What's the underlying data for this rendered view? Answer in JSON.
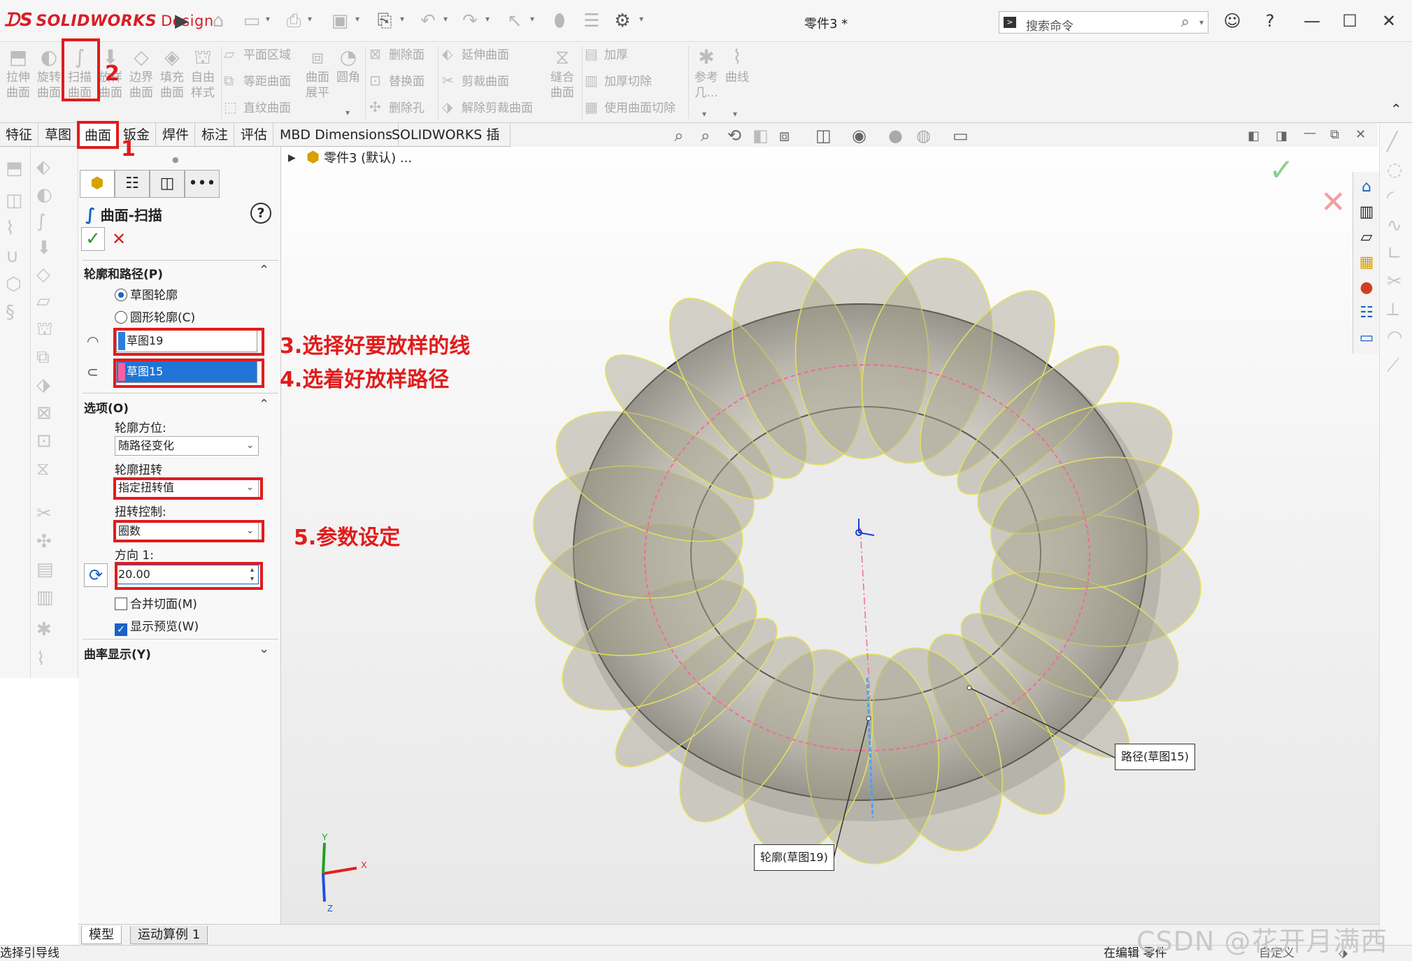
{
  "titlebar": {
    "brand": "SOLIDWORKS",
    "brand_suffix": "Design",
    "doc_title": "零件3 *",
    "search_placeholder": "搜索命令"
  },
  "ribbon": {
    "big_buttons": [
      {
        "line1": "拉伸",
        "line2": "曲面"
      },
      {
        "line1": "旋转",
        "line2": "曲面"
      },
      {
        "line1": "扫描",
        "line2": "曲面"
      },
      {
        "line1": "放样",
        "line2": "曲面"
      },
      {
        "line1": "边界",
        "line2": "曲面"
      },
      {
        "line1": "填充",
        "line2": "曲面"
      },
      {
        "line1": "自由",
        "line2": "样式"
      }
    ],
    "group1": [
      "平面区域",
      "等距曲面",
      "直纹曲面"
    ],
    "surf_flatten": {
      "line1": "曲面",
      "line2": "展平"
    },
    "fillet": "圆角",
    "group2": [
      "删除面",
      "替换面",
      "删除孔"
    ],
    "group3": [
      "延伸曲面",
      "剪裁曲面",
      "解除剪裁曲面"
    ],
    "knit": {
      "line1": "缝合",
      "line2": "曲面"
    },
    "group4": [
      "加厚",
      "加厚切除",
      "使用曲面切除"
    ],
    "ref": {
      "line1": "参考",
      "line2": "几..."
    },
    "curves": "曲线"
  },
  "tabs": [
    "特征",
    "草图",
    "曲面",
    "钣金",
    "焊件",
    "标注",
    "评估",
    "MBD Dimensions",
    "SOLIDWORKS 插件"
  ],
  "tree": {
    "root": "零件3 (默认) ..."
  },
  "pm": {
    "title": "曲面-扫描",
    "help": "?",
    "sec_profile": "轮廓和路径(P)",
    "radio_sketch": "草图轮廓",
    "radio_circle": "圆形轮廓(C)",
    "profile_sel": "草图19",
    "path_sel": "草图15",
    "sec_options": "选项(O)",
    "orient_label": "轮廓方位:",
    "orient_value": "随路径变化",
    "twist_label": "轮廓扭转",
    "twist_value": "指定扭转值",
    "twist_ctrl_label": "扭转控制:",
    "twist_ctrl_value": "圈数",
    "dir_label": "方向 1:",
    "dir_value": "20.00",
    "merge": "合并切面(M)",
    "preview": "显示预览(W)",
    "sec_curv": "曲率显示(Y)"
  },
  "annotations": {
    "n1": "1",
    "n2": "2",
    "n3": "3.选择好要放样的线",
    "n4": "4.选着好放样路径",
    "n5": "5.参数设定"
  },
  "callouts": {
    "path": "路径(草图15)",
    "profile": "轮廓(草图19)"
  },
  "triad": {
    "x": "X",
    "y": "Y",
    "z": "Z"
  },
  "bottom_tabs": [
    "模型",
    "运动算例 1"
  ],
  "status": {
    "left": "选择引导线",
    "right": "在编辑 零件",
    "custom": "自定义"
  },
  "watermark": "CSDN @花开月满西楼"
}
